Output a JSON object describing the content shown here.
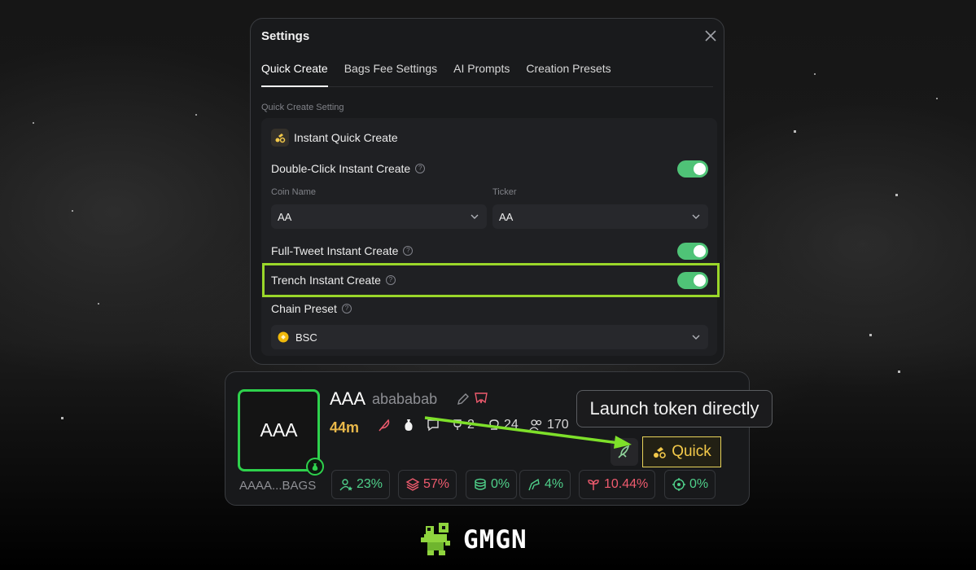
{
  "settings": {
    "title": "Settings",
    "tabs": [
      {
        "label": "Quick Create"
      },
      {
        "label": "Bags Fee Settings"
      },
      {
        "label": "AI Prompts"
      },
      {
        "label": "Creation Presets"
      }
    ],
    "section_label": "Quick Create Setting",
    "instant_quick_create": "Instant Quick Create",
    "double_click": {
      "label": "Double-Click Instant Create",
      "enabled": true
    },
    "coin_name": {
      "label": "Coin Name",
      "value": "AA"
    },
    "ticker": {
      "label": "Ticker",
      "value": "AA"
    },
    "full_tweet": {
      "label": "Full-Tweet Instant Create",
      "enabled": true
    },
    "trench": {
      "label": "Trench Instant Create",
      "enabled": true
    },
    "chain_preset": {
      "label": "Chain Preset",
      "value": "BSC"
    }
  },
  "token": {
    "thumb_text": "AAA",
    "address": "AAAA...BAGS",
    "symbol": "AAA",
    "name": "abababab",
    "age": "44m",
    "stat_a": "2",
    "stat_b": "24",
    "holders": "170",
    "pills": [
      {
        "value": "23%",
        "color": "#4fd08a",
        "icon": "user-star-icon"
      },
      {
        "value": "57%",
        "color": "#ef5b6e",
        "icon": "layers-icon"
      },
      {
        "value": "0%",
        "color": "#4fd08a",
        "icon": "coins-icon"
      },
      {
        "value": "4%",
        "color": "#4fd08a",
        "icon": "sniper-icon"
      },
      {
        "value": "10.44%",
        "color": "#ef5b6e",
        "icon": "bundle-icon"
      },
      {
        "value": "0%",
        "color": "#4fd08a",
        "icon": "target-icon"
      }
    ]
  },
  "tooltip": "Launch token directly",
  "quick_button": "Quick",
  "brand": "GMGN",
  "colors": {
    "toggle_on": "#4fc377",
    "highlight": "#9ad72a",
    "accent_yellow": "#f3c94a",
    "green": "#2ed14c",
    "red": "#ef5b6e"
  }
}
